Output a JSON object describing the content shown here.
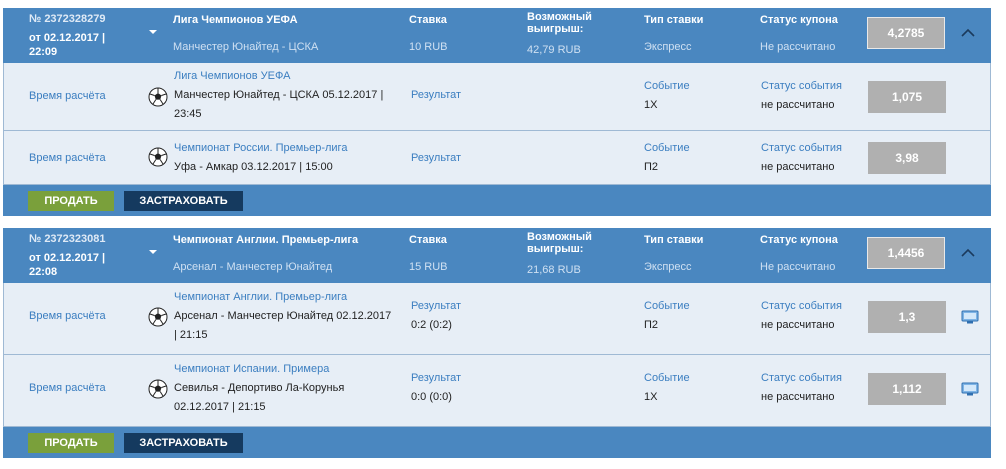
{
  "coupons": [
    {
      "number": "№ 2372328279",
      "date": "от 02.12.2017 | 22:09",
      "tournament": "Лига Чемпионов УЕФА",
      "match": "Манчестер Юнайтед - ЦСКА",
      "stake_label": "Ставка",
      "stake": "10 RUB",
      "win_label": "Возможный выигрыш:",
      "win": "42,79 RUB",
      "bet_type_label": "Тип ставки",
      "bet_type": "Экспресс",
      "status_label": "Статус купона",
      "status": "Не рассчитано",
      "odds": "4,2785",
      "events": [
        {
          "time_label": "Время расчёта",
          "tournament": "Лига Чемпионов УЕФА",
          "match": "Манчестер Юнайтед - ЦСКА 05.12.2017 |",
          "time": "23:45",
          "result_label": "Результат",
          "result": "",
          "outcome_label": "Событие",
          "outcome": "1Х",
          "status_label": "Статус события",
          "status": "не рассчитано",
          "odds": "1,075"
        },
        {
          "time_label": "Время расчёта",
          "tournament": "Чемпионат России. Премьер-лига",
          "match": "Уфа - Амкар 03.12.2017 | 15:00",
          "time": "",
          "result_label": "Результат",
          "result": "",
          "outcome_label": "Событие",
          "outcome": "П2",
          "status_label": "Статус события",
          "status": "не рассчитано",
          "odds": "3,98"
        }
      ],
      "sell_label": "ПРОДАТЬ",
      "insure_label": "ЗАСТРАХОВАТЬ"
    },
    {
      "number": "№ 2372323081",
      "date": "от 02.12.2017 | 22:08",
      "tournament": "Чемпионат Англии. Премьер-лига",
      "match": "Арсенал - Манчестер Юнайтед",
      "stake_label": "Ставка",
      "stake": "15 RUB",
      "win_label": "Возможный выигрыш:",
      "win": "21,68 RUB",
      "bet_type_label": "Тип ставки",
      "bet_type": "Экспресс",
      "status_label": "Статус купона",
      "status": "Не рассчитано",
      "odds": "1,4456",
      "events": [
        {
          "time_label": "Время расчёта",
          "tournament": "Чемпионат Англии. Премьер-лига",
          "match": "Арсенал - Манчестер Юнайтед 02.12.2017",
          "time": "| 21:15",
          "result_label": "Результат",
          "result": "0:2 (0:2)",
          "outcome_label": "Событие",
          "outcome": "П2",
          "status_label": "Статус события",
          "status": "не рассчитано",
          "odds": "1,3"
        },
        {
          "time_label": "Время расчёта",
          "tournament": "Чемпионат Испании. Примера",
          "match": "Севилья - Депортиво Ла-Корунья",
          "time": "02.12.2017 | 21:15",
          "result_label": "Результат",
          "result": "0:0 (0:0)",
          "outcome_label": "Событие",
          "outcome": "1Х",
          "status_label": "Статус события",
          "status": "не рассчитано",
          "odds": "1,112"
        }
      ],
      "sell_label": "ПРОДАТЬ",
      "insure_label": "ЗАСТРАХОВАТЬ"
    }
  ],
  "icons": {
    "ball": "soccer-ball-icon",
    "caret": "caret-down-icon",
    "collapse": "chevron-up-icon",
    "tv": "live-tv-icon"
  },
  "colors": {
    "header": "#4a87c0",
    "row": "#e7eef6",
    "odds": "#b0b0b0",
    "sell": "#7aa03b",
    "insure": "#153a5f"
  }
}
